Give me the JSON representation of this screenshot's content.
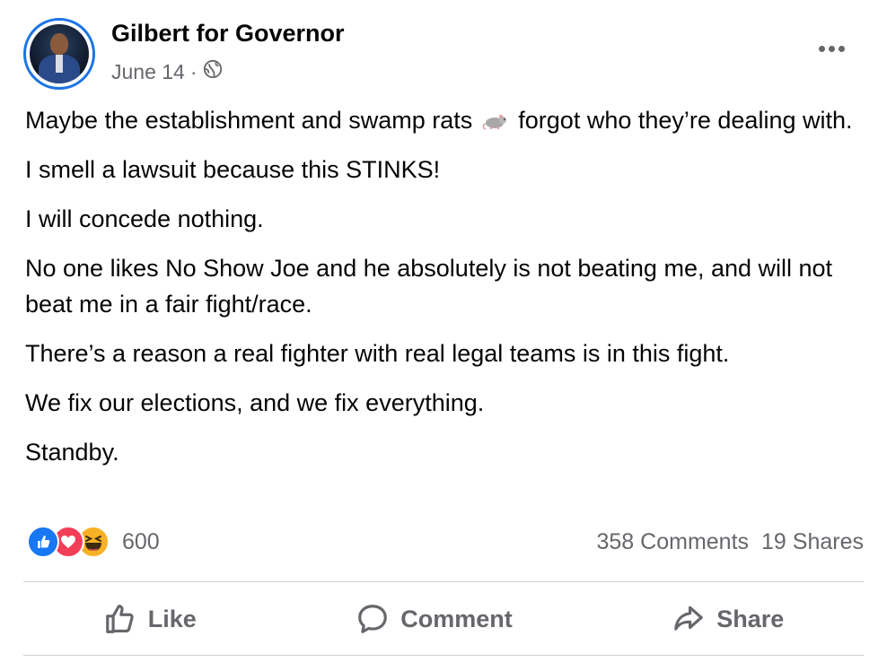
{
  "post": {
    "author": "Gilbert for Governor",
    "date": "June 14",
    "separator": "·",
    "privacy_icon": "globe-icon",
    "paragraphs": {
      "p1_before": "Maybe the establishment and swamp rats",
      "p1_after": "forgot who they’re dealing with.",
      "p2": "I smell a lawsuit because this STINKS!",
      "p3": "I will concede nothing.",
      "p4": "No one likes No Show Joe and he absolutely is not beating me, and will not beat me in a fair fight/race.",
      "p5": "There’s a reason a real fighter with real legal teams is in this fight.",
      "p6": "We fix our elections, and we fix everything.",
      "p7": "Standby."
    },
    "inline_emoji": "rat-icon"
  },
  "stats": {
    "reaction_icons": [
      "like-reaction-icon",
      "love-reaction-icon",
      "haha-reaction-icon"
    ],
    "reaction_count": "600",
    "comments": "358 Comments",
    "shares": "19 Shares"
  },
  "actions": {
    "like": "Like",
    "comment": "Comment",
    "share": "Share"
  },
  "colors": {
    "accent": "#1b74e4",
    "secondary_text": "#65676b",
    "like": "#1877f2",
    "love": "#f33e58",
    "haha": "#f7b125"
  }
}
